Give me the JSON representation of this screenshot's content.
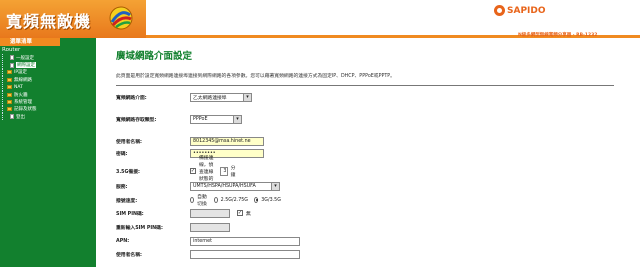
{
  "banner": {
    "title": "寬頻無敵機"
  },
  "brand": {
    "name": "SAPIDO",
    "product": "N級多網型無線寬頻分享器 · RB-1232"
  },
  "sidebar": {
    "menu_tab": "選單清單",
    "root": "Router",
    "items": [
      {
        "label": "一般設定",
        "type": "page"
      },
      {
        "label": "網際設定",
        "type": "page",
        "selected": true
      },
      {
        "label": "IP設定",
        "type": "folder"
      },
      {
        "label": "無線網路",
        "type": "folder"
      },
      {
        "label": "NAT",
        "type": "folder"
      },
      {
        "label": "防火牆",
        "type": "folder"
      },
      {
        "label": "系統管理",
        "type": "folder"
      },
      {
        "label": "記錄及狀態",
        "type": "folder"
      },
      {
        "label": "登出",
        "type": "page"
      }
    ]
  },
  "main": {
    "title": "廣域網路介面設定",
    "description": "此頁面是用於設定寬頻網路連接埠連接到網際網路的各項參數。您可以藉著寬頻網路的連接方式為固定IP、DHCP、PPPoE或PPTP。",
    "fields": {
      "wan_interface": {
        "label": "寬頻網路介面:",
        "value": "乙太網路連接埠"
      },
      "wan_type": {
        "label": "寬頻網路存取類型:",
        "value": "PPPoE"
      },
      "username": {
        "label": "使用者名稱:",
        "value": "8012345@msa.hinet.ne"
      },
      "password": {
        "label": "密碼:",
        "value": "••••••••"
      },
      "backup_3g": {
        "label": "3.5G備援:",
        "text": "備援連線，偵查連線狀態的時間",
        "minutes": "3",
        "unit": "分鐘"
      },
      "service": {
        "label": "服務:",
        "value": "UMTS/HSPA/HSUPA/HSUFA"
      },
      "connect_speed": {
        "label": "撥號速度:",
        "options": [
          "自動切換",
          "2.5G/2.75G",
          "3G/3.5G"
        ],
        "selected": 2
      },
      "sim_pin": {
        "label": "SIM PIN碼:",
        "value": "",
        "checkbox_label": "無"
      },
      "sim_pin_confirm": {
        "label": "重新輸入SIM PIN碼:",
        "value": ""
      },
      "apn": {
        "label": "APN:",
        "value": "internet"
      },
      "apn_user": {
        "label": "使用者名稱:",
        "value": ""
      }
    }
  }
}
